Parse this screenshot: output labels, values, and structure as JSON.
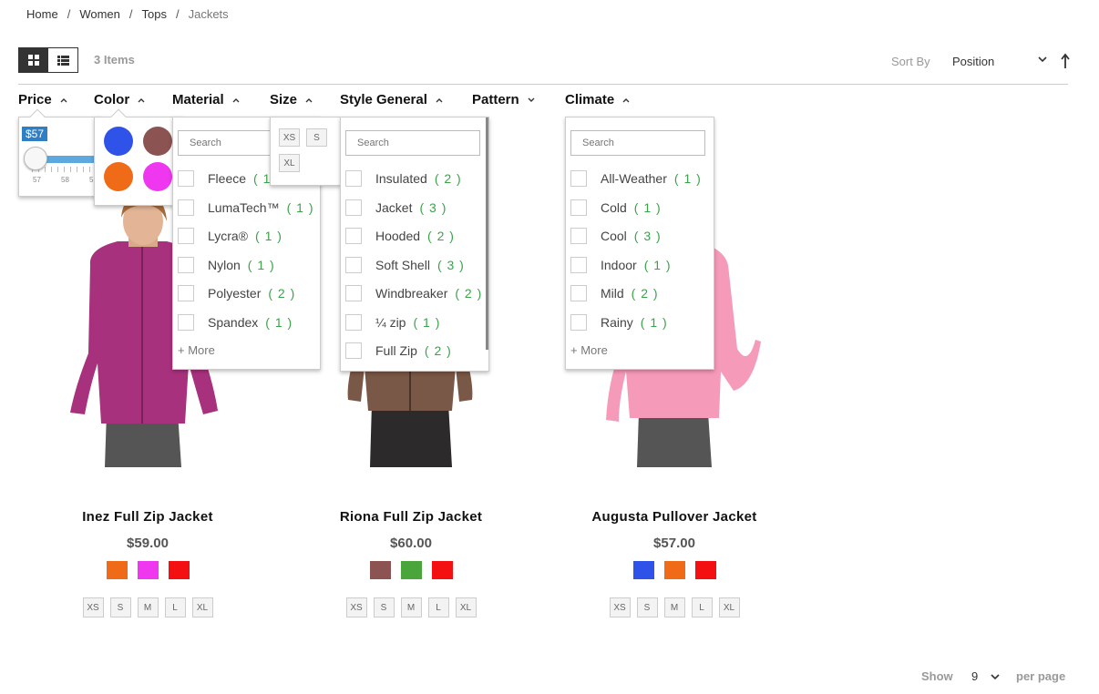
{
  "breadcrumb": [
    "Home",
    "Women",
    "Tops",
    "Jackets"
  ],
  "toolbar": {
    "items_count": "3 Items",
    "sort_label": "Sort By",
    "sort_value": "Position",
    "limiter_show": "Show",
    "limiter_value": "9",
    "limiter_per_page": "per page"
  },
  "filters": [
    "Price",
    "Color",
    "Material",
    "Size",
    "Style General",
    "Pattern",
    "Climate"
  ],
  "price_filter": {
    "badge": "$57",
    "ticks": [
      "57",
      "58",
      "5"
    ]
  },
  "color_filter": {
    "swatches": [
      "#2f52e8",
      "#8b5351",
      "#ef6b17",
      "#ef37ef"
    ]
  },
  "material_filter": {
    "search_placeholder": "Search",
    "options": [
      {
        "label": "Fleece",
        "count": "( 1 )"
      },
      {
        "label": "LumaTech™",
        "count": "( 1 )"
      },
      {
        "label": "Lycra®",
        "count": "( 1 )"
      },
      {
        "label": "Nylon",
        "count": "( 1 )"
      },
      {
        "label": "Polyester",
        "count": "( 2 )"
      },
      {
        "label": "Spandex",
        "count": "( 1 )"
      }
    ],
    "more": "+ More"
  },
  "size_filter": {
    "sizes": [
      "XS",
      "S",
      "XL"
    ]
  },
  "style_filter": {
    "search_placeholder": "Search",
    "options": [
      {
        "label": "Insulated",
        "count": "( 2 )"
      },
      {
        "label": "Jacket",
        "count": "( 3 )"
      },
      {
        "label": "Hooded",
        "count": "( 2 )"
      },
      {
        "label": "Soft Shell",
        "count": "( 3 )"
      },
      {
        "label": "Windbreaker",
        "count": "( 2 )"
      },
      {
        "label": "¼ zip",
        "count": "( 1 )"
      },
      {
        "label": "Full Zip",
        "count": "( 2 )"
      }
    ]
  },
  "climate_filter": {
    "search_placeholder": "Search",
    "options": [
      {
        "label": "All-Weather",
        "count": "( 1 )"
      },
      {
        "label": "Cold",
        "count": "( 1 )"
      },
      {
        "label": "Cool",
        "count": "( 3 )"
      },
      {
        "label": "Indoor",
        "count": "( 1 )"
      },
      {
        "label": "Mild",
        "count": "( 2 )"
      },
      {
        "label": "Rainy",
        "count": "( 1 )"
      }
    ],
    "more": "+ More"
  },
  "products": [
    {
      "name": "Inez Full Zip Jacket",
      "price": "$59.00",
      "colors": [
        "#ef6b17",
        "#ef37ef",
        "#f41010"
      ],
      "sizes": [
        "XS",
        "S",
        "M",
        "L",
        "XL"
      ],
      "garment": "#a8317d",
      "garment_dark": "#7a2058"
    },
    {
      "name": "Riona Full Zip Jacket",
      "price": "$60.00",
      "colors": [
        "#8b5351",
        "#4aa53a",
        "#f41010"
      ],
      "sizes": [
        "XS",
        "S",
        "M",
        "L",
        "XL"
      ],
      "garment": "#7a5847",
      "garment_dark": "#4a3328"
    },
    {
      "name": "Augusta Pullover Jacket",
      "price": "$57.00",
      "colors": [
        "#2f52e8",
        "#ef6b17",
        "#f41010"
      ],
      "sizes": [
        "XS",
        "S",
        "M",
        "L",
        "XL"
      ],
      "garment": "#f59ab8",
      "garment_dark": "#d8799a"
    }
  ]
}
